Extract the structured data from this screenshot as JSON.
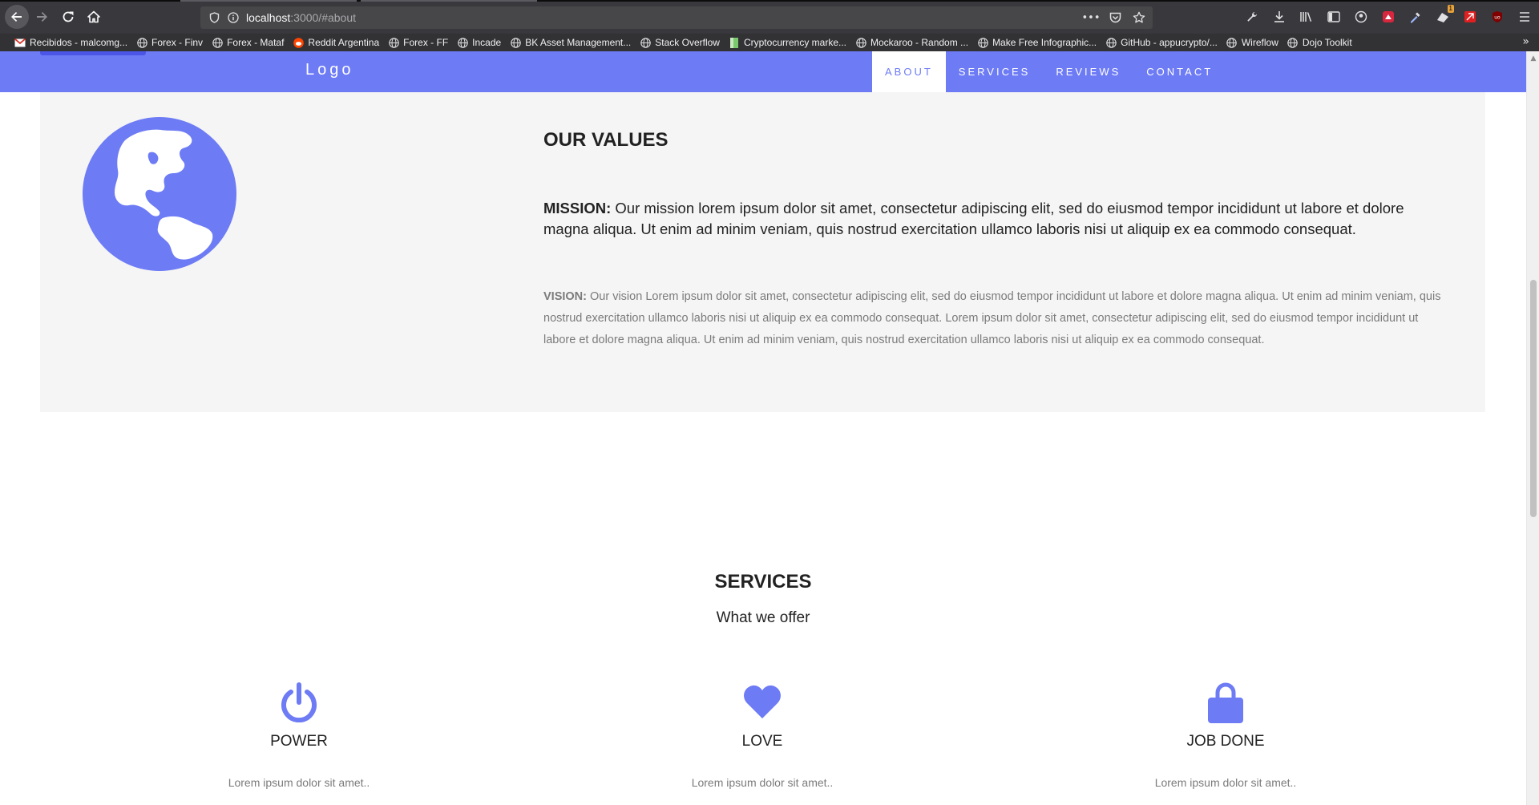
{
  "colors": {
    "accent": "#6d7bf5",
    "section_bg": "#f5f5f5",
    "chrome_bg": "#38383d"
  },
  "browser": {
    "url_host": "localhost",
    "url_rest": ":3000/#about",
    "bookmarks": [
      {
        "label": "Recibidos - malcomg...",
        "icon": "gmail-icon"
      },
      {
        "label": "Forex - Finv",
        "icon": "globe-icon"
      },
      {
        "label": "Forex - Mataf",
        "icon": "globe-icon"
      },
      {
        "label": "Reddit Argentina",
        "icon": "reddit-icon"
      },
      {
        "label": "Forex - FF",
        "icon": "globe-icon"
      },
      {
        "label": "Incade",
        "icon": "globe-icon"
      },
      {
        "label": "BK Asset Management...",
        "icon": "globe-icon"
      },
      {
        "label": "Stack Overflow",
        "icon": "globe-icon"
      },
      {
        "label": "Cryptocurrency marke...",
        "icon": "chart-icon"
      },
      {
        "label": "Mockaroo - Random ...",
        "icon": "globe-icon"
      },
      {
        "label": "Make Free Infographic...",
        "icon": "globe-icon"
      },
      {
        "label": "GitHub - appucrypto/...",
        "icon": "globe-icon"
      },
      {
        "label": "Wireflow",
        "icon": "globe-icon"
      },
      {
        "label": "Dojo Toolkit",
        "icon": "globe-icon"
      }
    ],
    "extension_badge": "1"
  },
  "navbar": {
    "logo": "Logo",
    "items": [
      {
        "label": "ABOUT",
        "active": true
      },
      {
        "label": "SERVICES",
        "active": false
      },
      {
        "label": "REVIEWS",
        "active": false
      },
      {
        "label": "CONTACT",
        "active": false
      }
    ]
  },
  "values": {
    "title": "OUR VALUES",
    "mission_label": "MISSION:",
    "mission_text": " Our mission lorem ipsum dolor sit amet, consectetur adipiscing elit, sed do eiusmod tempor incididunt ut labore et dolore magna aliqua. Ut enim ad minim veniam, quis nostrud exercitation ullamco laboris nisi ut aliquip ex ea commodo consequat.",
    "vision_label": "VISION:",
    "vision_text": " Our vision Lorem ipsum dolor sit amet, consectetur adipiscing elit, sed do eiusmod tempor incididunt ut labore et dolore magna aliqua. Ut enim ad minim veniam, quis nostrud exercitation ullamco laboris nisi ut aliquip ex ea commodo consequat. Lorem ipsum dolor sit amet, consectetur adipiscing elit, sed do eiusmod tempor incididunt ut labore et dolore magna aliqua. Ut enim ad minim veniam, quis nostrud exercitation ullamco laboris nisi ut aliquip ex ea commodo consequat."
  },
  "services": {
    "title": "SERVICES",
    "subtitle": "What we offer",
    "items": [
      {
        "icon": "power-icon",
        "title": "POWER",
        "text": "Lorem ipsum dolor sit amet.."
      },
      {
        "icon": "heart-icon",
        "title": "LOVE",
        "text": "Lorem ipsum dolor sit amet.."
      },
      {
        "icon": "lock-icon",
        "title": "JOB DONE",
        "text": "Lorem ipsum dolor sit amet.."
      }
    ]
  }
}
